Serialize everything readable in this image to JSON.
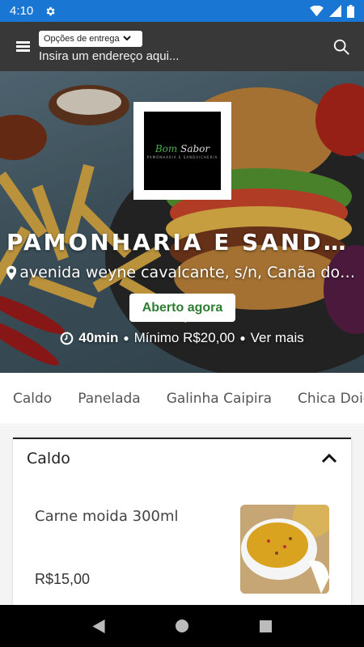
{
  "status_bar": {
    "time": "4:10",
    "icons": [
      "settings-icon",
      "wifi-icon",
      "signal-icon",
      "battery-icon"
    ],
    "color": "#1976d2"
  },
  "header": {
    "delivery_options_label": "Opções de entrega",
    "address_placeholder": "Insira um endereço aqui...",
    "background": "#383838"
  },
  "store": {
    "logo_text_1": "Bom",
    "logo_text_2": "Sabor",
    "logo_subtext": "PAMONHARIA E SANDUICHERIA",
    "name": "PAMONHARIA E SANDUICHERIA BOM SABOR",
    "address": "avenida weyne cavalcante, s/n, Canãa dos Carajás",
    "status": "Aberto agora",
    "delivery_time": "40min",
    "minimum": "Mínimo R$20,00",
    "see_more": "Ver mais"
  },
  "categories": [
    "Caldo",
    "Panelada",
    "Galinha Caipira",
    "Chica Doida"
  ],
  "section": {
    "title": "Caldo",
    "products": [
      {
        "name": "Carne moida 300ml",
        "price": "R$15,00"
      }
    ]
  },
  "colors": {
    "open_status": "#2e7d32",
    "logo_accent": "#4caf50"
  }
}
